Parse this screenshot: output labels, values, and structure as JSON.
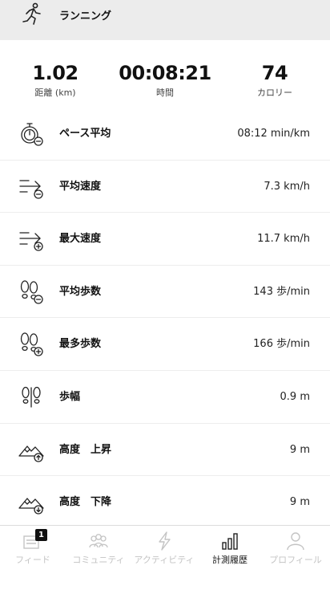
{
  "header": {
    "title": "ランニング",
    "icon": "runner-icon"
  },
  "summary": [
    {
      "value": "1.02",
      "label": "距離 (km)"
    },
    {
      "value": "00:08:21",
      "label": "時間"
    },
    {
      "value": "74",
      "label": "カロリー"
    }
  ],
  "metrics": [
    {
      "name": "ペース平均",
      "value": "08:12 min/km",
      "icon": "stopwatch-icon"
    },
    {
      "name": "平均速度",
      "value": "7.3 km/h",
      "icon": "speed-average-icon"
    },
    {
      "name": "最大速度",
      "value": "11.7 km/h",
      "icon": "speed-max-icon"
    },
    {
      "name": "平均歩数",
      "value": "143 歩/min",
      "icon": "footsteps-average-icon"
    },
    {
      "name": "最多歩数",
      "value": "166 歩/min",
      "icon": "footsteps-max-icon"
    },
    {
      "name": "歩幅",
      "value": "0.9 m",
      "icon": "stride-icon"
    },
    {
      "name": "高度　上昇",
      "value": "9 m",
      "icon": "mountain-up-icon"
    },
    {
      "name": "高度　下降",
      "value": "9 m",
      "icon": "mountain-down-icon"
    }
  ],
  "tabs": [
    {
      "label": "フィード",
      "badge": "1",
      "icon": "feed-icon",
      "active": false
    },
    {
      "label": "コミュニティ",
      "icon": "community-icon",
      "active": false
    },
    {
      "label": "アクティビティ",
      "icon": "bolt-icon",
      "active": false
    },
    {
      "label": "計測履歴",
      "icon": "bar-chart-icon",
      "active": true
    },
    {
      "label": "プロフィール",
      "icon": "profile-icon",
      "active": false
    }
  ]
}
